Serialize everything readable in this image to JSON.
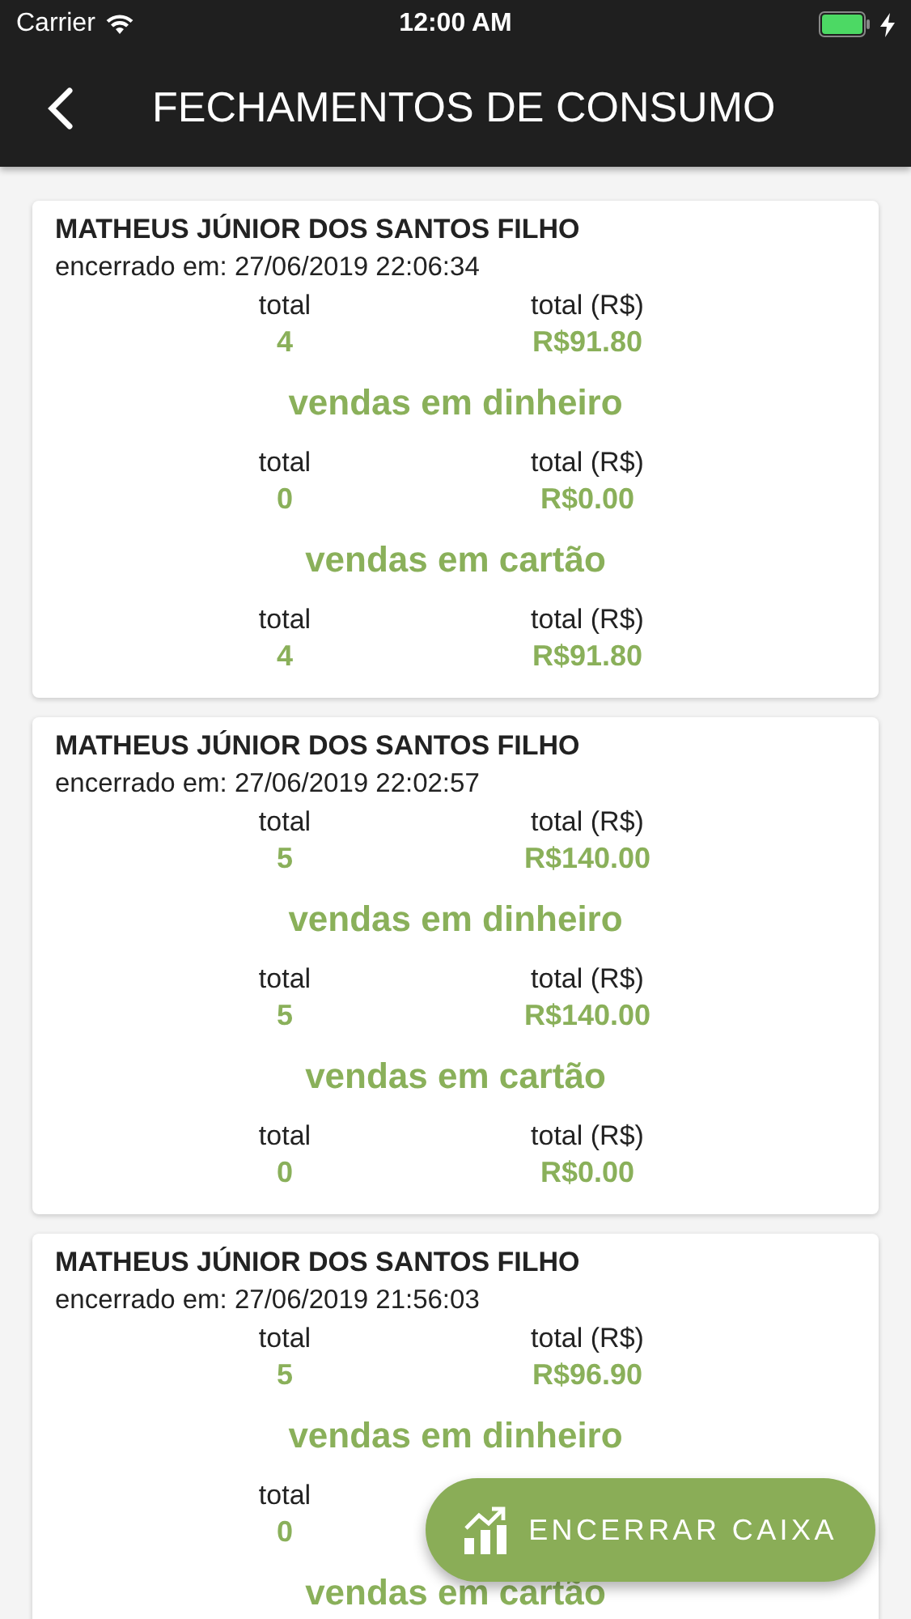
{
  "status_bar": {
    "carrier": "Carrier",
    "time": "12:00 AM",
    "charging": true
  },
  "header": {
    "title": "FECHAMENTOS DE CONSUMO"
  },
  "closings": [
    {
      "name": "MATHEUS JÚNIOR DOS SANTOS FILHO",
      "closed_at": "encerrado em: 27/06/2019 22:06:34",
      "groups": [
        {
          "cells": [
            {
              "kind": "count",
              "label": "total",
              "value": "4"
            },
            {
              "kind": "amount",
              "label": "total (R$)",
              "value": "R$91.80"
            }
          ]
        },
        {
          "heading": "vendas em dinheiro",
          "cells": [
            {
              "kind": "count",
              "label": "total",
              "value": "0"
            },
            {
              "kind": "amount",
              "label": "total (R$)",
              "value": "R$0.00"
            }
          ]
        },
        {
          "heading": "vendas em cartão",
          "cells": [
            {
              "kind": "count",
              "label": "total",
              "value": "4"
            },
            {
              "kind": "amount",
              "label": "total (R$)",
              "value": "R$91.80"
            }
          ]
        }
      ]
    },
    {
      "name": "MATHEUS JÚNIOR DOS SANTOS FILHO",
      "closed_at": "encerrado em: 27/06/2019 22:02:57",
      "groups": [
        {
          "cells": [
            {
              "kind": "count",
              "label": "total",
              "value": "5"
            },
            {
              "kind": "amount",
              "label": "total (R$)",
              "value": "R$140.00"
            }
          ]
        },
        {
          "heading": "vendas em dinheiro",
          "cells": [
            {
              "kind": "count",
              "label": "total",
              "value": "5"
            },
            {
              "kind": "amount",
              "label": "total (R$)",
              "value": "R$140.00"
            }
          ]
        },
        {
          "heading": "vendas em cartão",
          "cells": [
            {
              "kind": "count",
              "label": "total",
              "value": "0"
            },
            {
              "kind": "amount",
              "label": "total (R$)",
              "value": "R$0.00"
            }
          ]
        }
      ]
    },
    {
      "name": "MATHEUS JÚNIOR DOS SANTOS FILHO",
      "closed_at": "encerrado em: 27/06/2019 21:56:03",
      "groups": [
        {
          "cells": [
            {
              "kind": "count",
              "label": "total",
              "value": "5"
            },
            {
              "kind": "amount",
              "label": "total (R$)",
              "value": "R$96.90"
            }
          ]
        },
        {
          "heading": "vendas em dinheiro",
          "cells": [
            {
              "kind": "count",
              "label": "total",
              "value": "0"
            }
          ]
        },
        {
          "heading": "vendas em cartão"
        }
      ]
    }
  ],
  "action_button": {
    "label": "ENCERRAR CAIXA"
  }
}
